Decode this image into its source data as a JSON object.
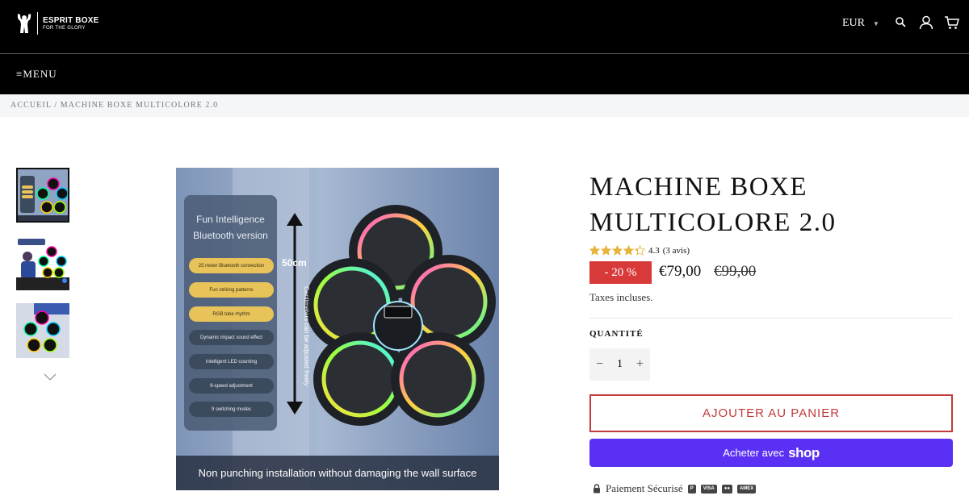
{
  "header": {
    "logo_name": "ESPRIT BOXE",
    "logo_tagline": "FOR THE GLORY",
    "currency": "EUR",
    "icons": [
      "search-icon",
      "account-icon",
      "cart-icon"
    ]
  },
  "nav": {
    "menu_label": "MENU"
  },
  "breadcrumb": {
    "home": "ACCUEIL",
    "separator": "/",
    "current": "MACHINE BOXE MULTICOLORE 2.0"
  },
  "gallery": {
    "thumbnail_count": 3,
    "active_index": 0,
    "main_image": {
      "panel_title_1": "Fun Intelligence",
      "panel_title_2": "Bluetooth version",
      "features": [
        "25 meter Bluetooth connection",
        "Fun striking patterns",
        "RGB tube rhythm",
        "Dynamic impact sound effect",
        "Intelligent LED counting",
        "9-speed adjustment",
        "9 switching modes"
      ],
      "dimension": "50cm",
      "dimension_note": "Centimeters can be adjusted freely",
      "caption": "Non punching installation without damaging the wall surface"
    }
  },
  "product": {
    "title": "MACHINE BOXE MULTICOLORE 2.0",
    "rating_value": "4.3",
    "rating_count": "(3 avis)",
    "rating_fraction": 0.86,
    "discount": "- 20 %",
    "price": "€79,00",
    "compare_price": "€99,00",
    "taxes": "Taxes incluses.",
    "quantity_label": "QUANTITÉ",
    "quantity": "1",
    "add_to_cart": "AJOUTER AU PANIER",
    "shop_pay_prefix": "Acheter avec",
    "shop_pay_brand": "shop",
    "secure_payment": "Paiement Sécurisé",
    "payment_icons": [
      "P",
      "VISA",
      "●●",
      "AMEX"
    ]
  },
  "colors": {
    "header_bg": "#000000",
    "accent_red": "#d83a3a",
    "shop_pay": "#5a31f4",
    "star": "#e6b43c"
  }
}
